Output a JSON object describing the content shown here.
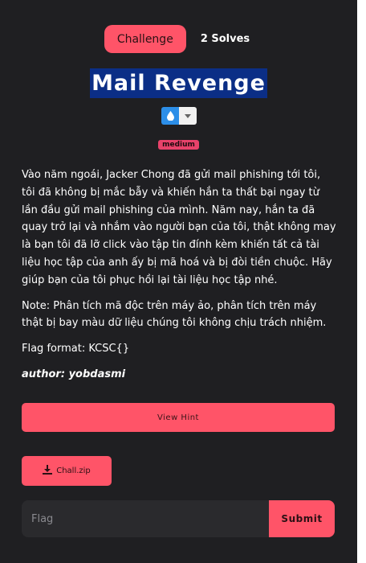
{
  "tabs": {
    "challenge_label": "Challenge",
    "solves_label": "2 Solves"
  },
  "challenge": {
    "title": "Mail Revenge",
    "difficulty": "medium",
    "rating_icon": "water-drop-icon",
    "description": [
      "Vào năm ngoái, Jacker Chong đã gửi mail phishing tới tôi, tôi đã không bị mắc bẫy và khiến hắn ta thất bại ngay từ lần đầu gửi mail phishing của mình. Năm nay, hắn ta đã quay trở lại và nhắm vào người bạn của tôi, thật không may là bạn tôi đã lỡ click vào tập tin đính kèm khiến tất cả tài liệu học tập của anh ấy bị mã hoá và bị đòi tiền chuộc. Hãy giúp bạn của tôi phục hồi lại tài liệu học tập nhé.",
      "Note: Phân tích mã độc trên máy ảo, phân tích trên máy thật bị bay màu dữ liệu chúng tôi không chịu trách nhiệm.",
      "Flag format: KCSC{}"
    ],
    "author": "author: yobdasmi"
  },
  "actions": {
    "hint_label": "View Hint",
    "file_label": "Chall.zip",
    "file_icon": "download-icon"
  },
  "form": {
    "flag_placeholder": "Flag",
    "submit_label": "Submit"
  },
  "colors": {
    "accent": "#ff5468",
    "background": "#1f1f22",
    "title_highlight": "#0b2e86",
    "badge": "#e8426a"
  }
}
